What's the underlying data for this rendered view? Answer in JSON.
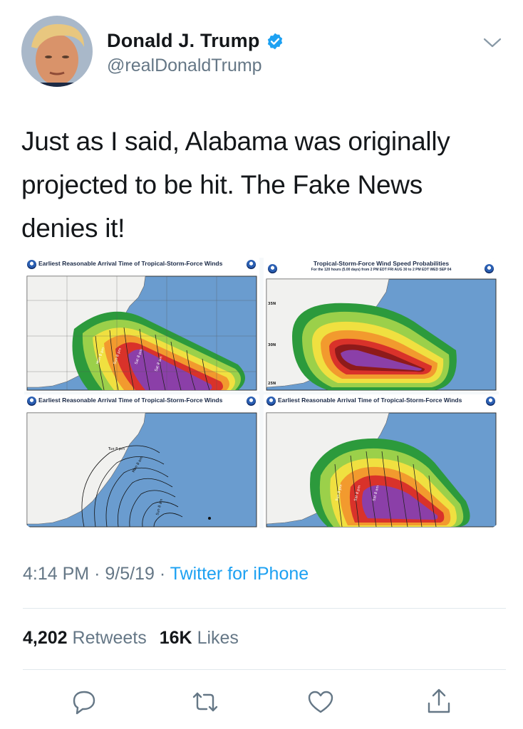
{
  "user": {
    "display_name": "Donald J. Trump",
    "handle": "@realDonaldTrump",
    "verified": true
  },
  "tweet": {
    "lines": [
      "Just as I said, Alabama was originally",
      "projected to be hit. The Fake News",
      "denies it!"
    ]
  },
  "media": {
    "maps": [
      {
        "title": "Earliest Reasonable Arrival Time of Tropical-Storm-Force Winds"
      },
      {
        "title": "Tropical-Storm-Force Wind Speed Probabilities",
        "subtitle": "For the 120 hours (5.00 days) from 2 PM EDT FRI AUG 30 to 2 PM EDT WED SEP 04"
      },
      {
        "title": "Earliest Reasonable Arrival Time of Tropical-Storm-Force Winds"
      },
      {
        "title": "Earliest Reasonable Arrival Time of Tropical-Storm-Force Winds"
      }
    ]
  },
  "meta": {
    "time": "4:14 PM",
    "separator": "·",
    "date": "9/5/19",
    "source": "Twitter for iPhone"
  },
  "stats": {
    "retweets_count": "4,202",
    "retweets_label": "Retweets",
    "likes_count": "16K",
    "likes_label": "Likes"
  },
  "actions": {
    "reply_icon": "reply-icon",
    "retweet_icon": "retweet-icon",
    "like_icon": "heart-icon",
    "share_icon": "share-icon"
  },
  "colors": {
    "text": "#14171a",
    "secondary": "#657786",
    "link": "#1da1f2",
    "ocean": "#6a9ccf",
    "land": "#f1f1ef"
  }
}
